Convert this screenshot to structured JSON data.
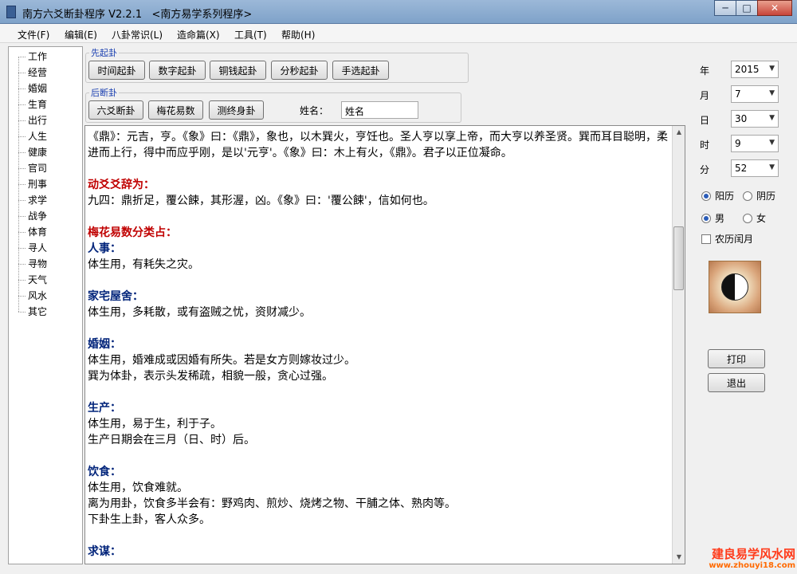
{
  "window": {
    "title": "南方六爻断卦程序 V2.2.1   <南方易学系列程序>",
    "min_label": "─",
    "max_label": "□",
    "close_label": "✕"
  },
  "menu": [
    "文件(F)",
    "编辑(E)",
    "八卦常识(L)",
    "造命篇(X)",
    "工具(T)",
    "帮助(H)"
  ],
  "tree": [
    "工作",
    "经营",
    "婚姻",
    "生育",
    "出行",
    "人生",
    "健康",
    "官司",
    "刑事",
    "求学",
    "战争",
    "体育",
    "寻人",
    "寻物",
    "天气",
    "风水",
    "其它"
  ],
  "group1": {
    "title": "先起卦",
    "buttons": [
      "时间起卦",
      "数字起卦",
      "铜钱起卦",
      "分秒起卦",
      "手选起卦"
    ]
  },
  "group2": {
    "title": "后断卦",
    "buttons": [
      "六爻断卦",
      "梅花易数",
      "测终身卦"
    ]
  },
  "name": {
    "label": "姓名：",
    "value": "姓名"
  },
  "content": {
    "p1": "《鼎》：元吉，亨。《象》曰：《鼎》，象也，以木巽火，亨饪也。圣人亨以享上帝，而大亨以养圣贤。巽而耳目聪明，柔进而上行，得中而应乎刚，是以'元亨'。《象》曰：木上有火，《鼎》。君子以正位凝命。",
    "h1": "动爻爻辞为：",
    "p2": "九四：鼎折足，覆公餗，其形渥，凶。《象》曰：'覆公餗'，信如何也。",
    "h2": "梅花易数分类占：",
    "s1": "人事：",
    "s1l1": "体生用，有耗失之灾。",
    "s2": "家宅屋舍：",
    "s2l1": "体生用，多耗散，或有盗贼之忧，资财减少。",
    "s3": "婚姻：",
    "s3l1": "体生用，婚难成或因婚有所失。若是女方则嫁妆过少。",
    "s3l2": "巽为体卦，表示头发稀疏，相貌一般，贪心过强。",
    "s4": "生产：",
    "s4l1": "体生用，易于生，利于子。",
    "s4l2": "生产日期会在三月（日、时）后。",
    "s5": "饮食：",
    "s5l1": "体生用，饮食难就。",
    "s5l2": "离为用卦，饮食多半会有：野鸡肉、煎炒、烧烤之物、干脯之体、熟肉等。",
    "s5l3": "下卦生上卦，客人众多。",
    "s6": "求谋："
  },
  "datetime": {
    "year": {
      "label": "年",
      "value": "2015"
    },
    "month": {
      "label": "月",
      "value": "7"
    },
    "day": {
      "label": "日",
      "value": "30"
    },
    "hour": {
      "label": "时",
      "value": "9"
    },
    "minute": {
      "label": "分",
      "value": "52"
    }
  },
  "calendar": {
    "solar": "阳历",
    "lunar": "阴历",
    "selected": "solar"
  },
  "gender": {
    "male": "男",
    "female": "女",
    "selected": "male"
  },
  "leap_label": "农历闰月",
  "actions": {
    "print": "打印",
    "exit": "退出"
  },
  "watermark": {
    "line1": "建良易学风水网",
    "line2": "www.zhouyi18.com"
  }
}
